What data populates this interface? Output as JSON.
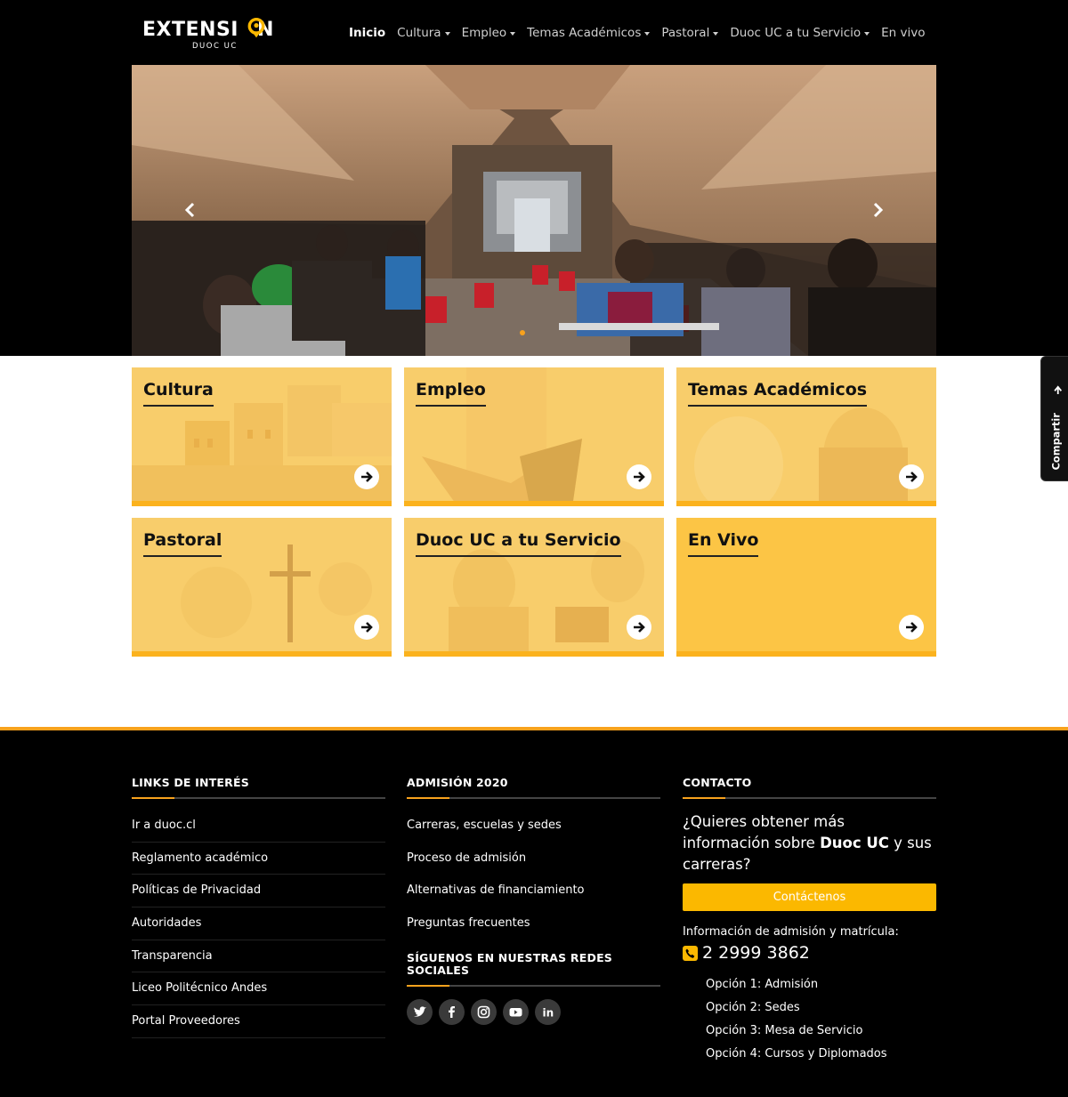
{
  "header": {
    "logo_main": "EXTENSI",
    "logo_end": "N",
    "logo_sub": "DUOC UC",
    "nav": [
      {
        "label": "Inicio",
        "active": true,
        "dropdown": false
      },
      {
        "label": "Cultura",
        "active": false,
        "dropdown": true
      },
      {
        "label": "Empleo",
        "active": false,
        "dropdown": true
      },
      {
        "label": "Temas Académicos",
        "active": false,
        "dropdown": true
      },
      {
        "label": "Pastoral",
        "active": false,
        "dropdown": true
      },
      {
        "label": "Duoc UC a tu Servicio",
        "active": false,
        "dropdown": true
      },
      {
        "label": "En vivo",
        "active": false,
        "dropdown": false
      }
    ]
  },
  "hero": {
    "prev_icon": "chevron-left-icon",
    "next_icon": "chevron-right-icon"
  },
  "cards": [
    {
      "title": "Cultura",
      "icon": "arrow-right-icon"
    },
    {
      "title": "Empleo",
      "icon": "arrow-right-icon"
    },
    {
      "title": "Temas Académicos",
      "icon": "arrow-right-icon"
    },
    {
      "title": "Pastoral",
      "icon": "arrow-right-icon"
    },
    {
      "title": "Duoc UC a tu Servicio",
      "icon": "arrow-right-icon"
    },
    {
      "title": "En Vivo",
      "icon": "arrow-right-icon"
    }
  ],
  "share": {
    "label": "Compartir"
  },
  "footer": {
    "links_title": "LINKS DE INTERÉS",
    "links": [
      "Ir a duoc.cl",
      "Reglamento académico",
      "Políticas de Privacidad",
      "Autoridades",
      "Transparencia",
      "Liceo Politécnico Andes",
      "Portal Proveedores"
    ],
    "admision_title": "ADMISIÓN 2020",
    "admision": [
      "Carreras, escuelas y sedes",
      "Proceso de admisión",
      "Alternativas de financiamiento",
      "Preguntas frecuentes"
    ],
    "social_title": "SÍGUENOS EN NUESTRAS REDES SOCIALES",
    "social": [
      "twitter-icon",
      "facebook-icon",
      "instagram-icon",
      "youtube-icon",
      "linkedin-icon"
    ],
    "contact_title": "CONTACTO",
    "contact_q1": "¿Quieres obtener más información sobre ",
    "contact_brand": "Duoc UC",
    "contact_q2": " y sus carreras?",
    "contact_button": "Contáctenos",
    "contact_info": "Información de admisión y matrícula:",
    "contact_phone": "2 2999 3862",
    "options": [
      "Opción 1: Admisión",
      "Opción 2: Sedes",
      "Opción 3: Mesa de Servicio",
      "Opción 4: Cursos y Diplomados"
    ]
  },
  "colors": {
    "accent": "#fbb800",
    "card_fill": "#f8cd6b",
    "card_border": "#fbb21d",
    "footer_line": "#f8a21d"
  }
}
